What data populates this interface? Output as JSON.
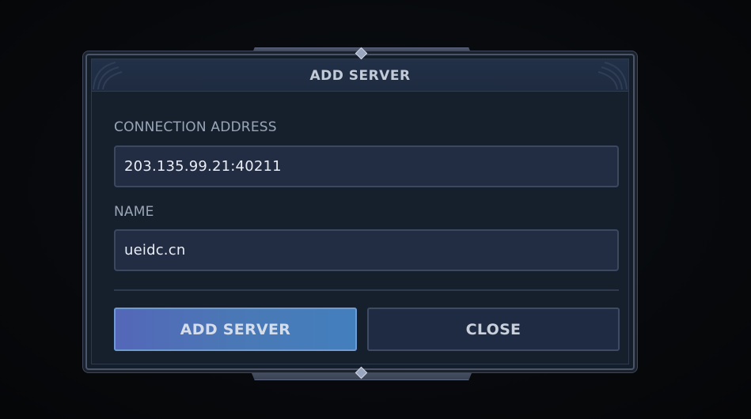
{
  "dialog": {
    "title": "ADD SERVER",
    "connection_address": {
      "label": "CONNECTION ADDRESS",
      "value": "203.135.99.21:40211"
    },
    "name": {
      "label": "NAME",
      "value": "ueidc.cn"
    },
    "buttons": {
      "add_server": "ADD SERVER",
      "close": "CLOSE"
    }
  },
  "colors": {
    "background": "#07090c",
    "panel": "#16202d",
    "titlebar": "#223048",
    "field_bg": "#222d44",
    "primary_button": "#4a78b6",
    "secondary_button": "#1f2b42",
    "label_text": "#9aa6b8"
  },
  "icons": {
    "corner_left": "ornament-corner-icon",
    "corner_right": "ornament-corner-icon"
  }
}
